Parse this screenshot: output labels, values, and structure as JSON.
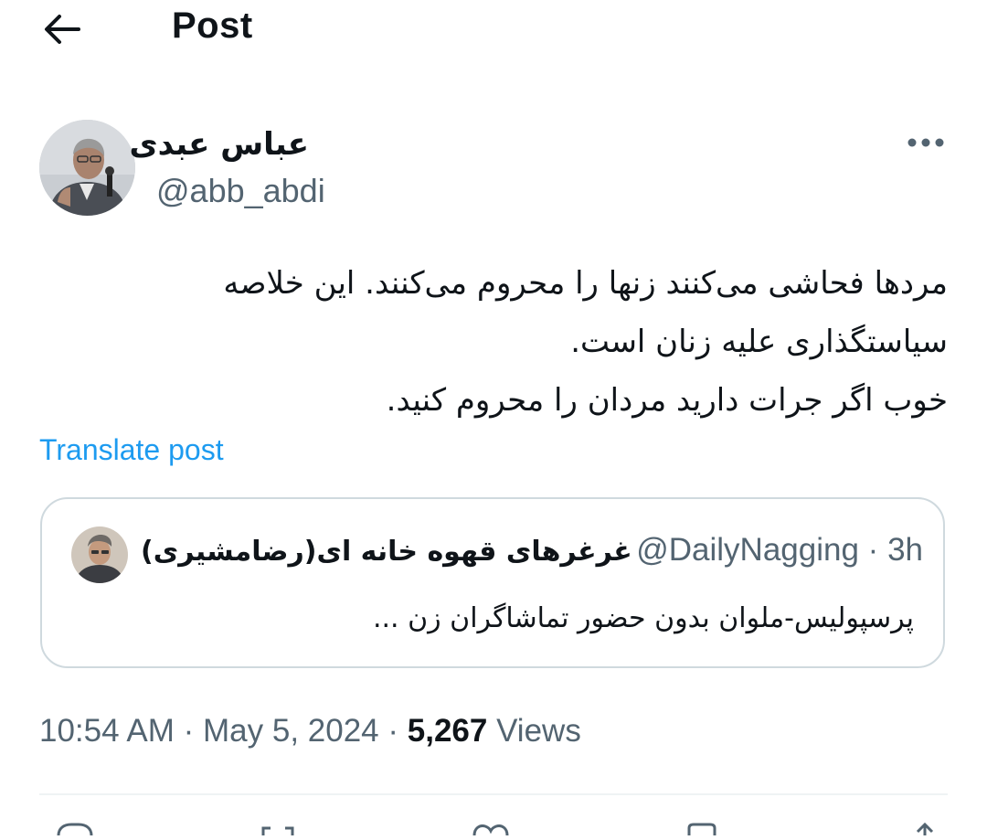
{
  "header": {
    "title": "Post"
  },
  "author": {
    "name": "عباس عبدی",
    "handle": "@abb_abdi"
  },
  "tweet": {
    "lines": [
      "مردها فحاشی می‌کنند زنها را محروم می‌کنند. این خلاصه",
      "سیاستگذاری علیه زنان است.",
      "خوب اگر جرات دارید مردان را محروم کنید."
    ],
    "translate_label": "Translate post"
  },
  "quote": {
    "name": "غرغرهای قهوه خانه ای(رضامشیری)",
    "handle": "@DailyNagging",
    "separator": "·",
    "time": "3h",
    "text": "پرسپولیس-ملوان بدون حضور تماشاگران زن ..."
  },
  "meta": {
    "time": "10:54 AM",
    "sep1": "·",
    "date": "May 5, 2024",
    "sep2": "·",
    "views_count": "5,267",
    "views_label": "Views"
  },
  "icons": {
    "back": "arrow-left-icon",
    "more": "more-horizontal-icon"
  },
  "colors": {
    "link": "#1d9bf0",
    "secondary_text": "#536471",
    "primary_text": "#0f1419",
    "border": "#cfd9de"
  }
}
